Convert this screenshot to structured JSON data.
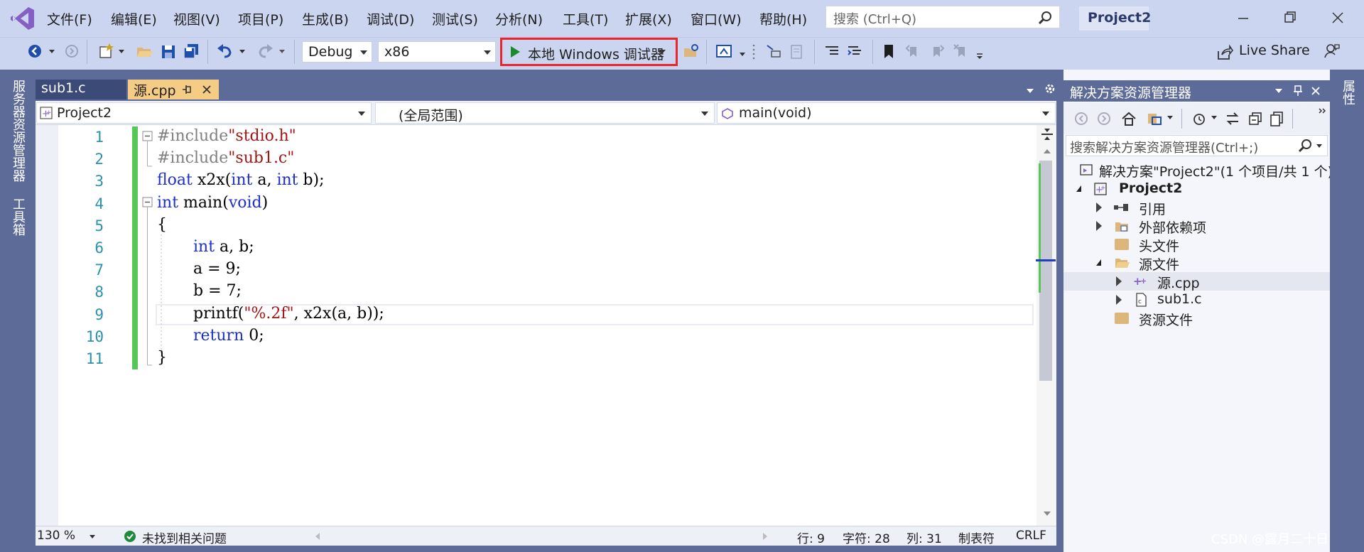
{
  "menu": [
    "文件(F)",
    "编辑(E)",
    "视图(V)",
    "项目(P)",
    "生成(B)",
    "调试(D)",
    "测试(S)",
    "分析(N)",
    "工具(T)",
    "扩展(X)",
    "窗口(W)",
    "帮助(H)"
  ],
  "search_placeholder": "搜索 (Ctrl+Q)",
  "project_badge": "Project2",
  "toolbar": {
    "config": "Debug",
    "platform": "x86",
    "run": "本地 Windows 调试器",
    "live_share": "Live Share"
  },
  "left_rail": [
    "服务器资源管理器",
    "工具箱"
  ],
  "right_rail": "属性",
  "tabs": [
    {
      "label": "sub1.c",
      "active": false
    },
    {
      "label": "源.cpp",
      "active": true
    }
  ],
  "nav": {
    "project": "Project2",
    "scope": "(全局范围)",
    "member": "main(void)"
  },
  "line_numbers": [
    "1",
    "2",
    "3",
    "4",
    "5",
    "6",
    "7",
    "8",
    "9",
    "10",
    "11"
  ],
  "code_lines": [
    "#include\"stdio.h\"",
    "#include\"sub1.c\"",
    "float x2x(int a, int b);",
    "int main(void)",
    "{",
    "int a, b;",
    "a = 9;",
    "b = 7;",
    "printf(\"%.2f\", x2x(a, b));",
    "return 0;",
    "}"
  ],
  "status": {
    "zoom": "130 %",
    "issues": "未找到相关问题",
    "line": "行: 9",
    "char": "字符: 28",
    "col": "列: 31",
    "tabs": "制表符",
    "eol": "CRLF"
  },
  "solution_explorer": {
    "title": "解决方案资源管理器",
    "search_placeholder": "搜索解决方案资源管理器(Ctrl+;)",
    "solution": "解决方案\"Project2\"(1 个项目/共 1 个)",
    "project": "Project2",
    "nodes": [
      "引用",
      "外部依赖项",
      "头文件",
      "源文件",
      "源.cpp",
      "sub1.c",
      "资源文件"
    ]
  },
  "watermark": "CSDN @露月二十日",
  "colors": {
    "accent": "#5d6b99",
    "run_highlight": "#e8262b",
    "keyword": "#1d2fc9",
    "string": "#a31515",
    "linenum": "#2b91af"
  }
}
